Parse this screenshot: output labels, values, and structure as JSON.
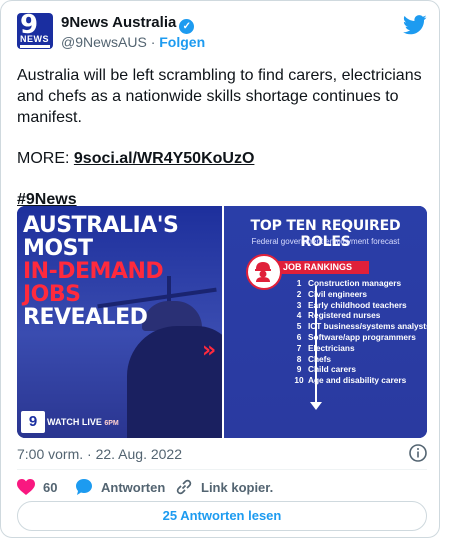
{
  "account": {
    "name": "9News Australia",
    "handle": "@9NewsAUS",
    "separator": "·",
    "follow_label": "Folgen",
    "avatar_text_top": "9",
    "avatar_text_bottom": "NEWS"
  },
  "tweet": {
    "text": "Australia will be left scrambling to find carers, electricians and chefs as a nationwide skills shortage continues to manifest.",
    "more_label": "MORE:",
    "link": "9soci.al/WR4Y50KoUzO",
    "hashtag": "#9News",
    "timestamp": "7:00 vorm. · 22. Aug. 2022"
  },
  "media": {
    "headline_line1": "AUSTRALIA'S MOST",
    "headline_line2": "IN-DEMAND JOBS",
    "headline_line3": "REVEALED",
    "chevrons": "»",
    "logo": "9",
    "watch_label": "WATCH LIVE",
    "watch_time": "6PM",
    "right_title": "TOP TEN REQUIRED ROLES",
    "right_subtitle": "Federal government employment forecast",
    "rankings_label": "JOB RANKINGS",
    "rankings": [
      {
        "rank": "1",
        "role": "Construction managers"
      },
      {
        "rank": "2",
        "role": "Civil engineers"
      },
      {
        "rank": "3",
        "role": "Early childhood teachers"
      },
      {
        "rank": "4",
        "role": "Registered nurses"
      },
      {
        "rank": "5",
        "role": "ICT business/systems analysts"
      },
      {
        "rank": "6",
        "role": "Software/app programmers"
      },
      {
        "rank": "7",
        "role": "Electricians"
      },
      {
        "rank": "8",
        "role": "Chefs"
      },
      {
        "rank": "9",
        "role": "Child carers"
      },
      {
        "rank": "10",
        "role": "Age and disability carers"
      }
    ]
  },
  "actions": {
    "likes": "60",
    "reply_label": "Antworten",
    "copy_link_label": "Link kopier.",
    "read_replies_label": "25 Antworten lesen"
  },
  "colors": {
    "accent": "#1d9bf0",
    "like": "#f91880",
    "brand_blue": "#1a2ea0",
    "brand_red": "#e0203a"
  },
  "icons": [
    "verified-badge-icon",
    "twitter-bird-icon",
    "info-icon",
    "heart-icon",
    "reply-bubble-icon",
    "link-icon",
    "hardhat-worker-icon"
  ]
}
